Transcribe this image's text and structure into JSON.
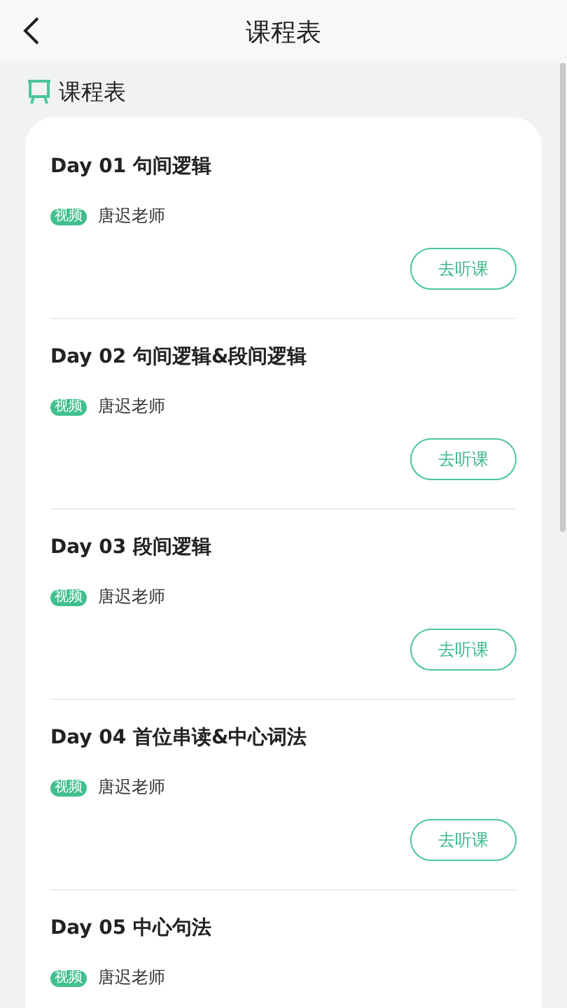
{
  "header": {
    "title": "课程表"
  },
  "section": {
    "title": "课程表"
  },
  "lessons": [
    {
      "title": "Day 01 句间逻辑",
      "tag": "视频",
      "teacher": "唐迟老师",
      "action": "去听课"
    },
    {
      "title": "Day 02 句间逻辑&段间逻辑",
      "tag": "视频",
      "teacher": "唐迟老师",
      "action": "去听课"
    },
    {
      "title": "Day 03 段间逻辑",
      "tag": "视频",
      "teacher": "唐迟老师",
      "action": "去听课"
    },
    {
      "title": "Day 04 首位串读&中心词法",
      "tag": "视频",
      "teacher": "唐迟老师",
      "action": "去听课"
    },
    {
      "title": "Day 05 中心句法",
      "tag": "视频",
      "teacher": "唐迟老师"
    }
  ]
}
